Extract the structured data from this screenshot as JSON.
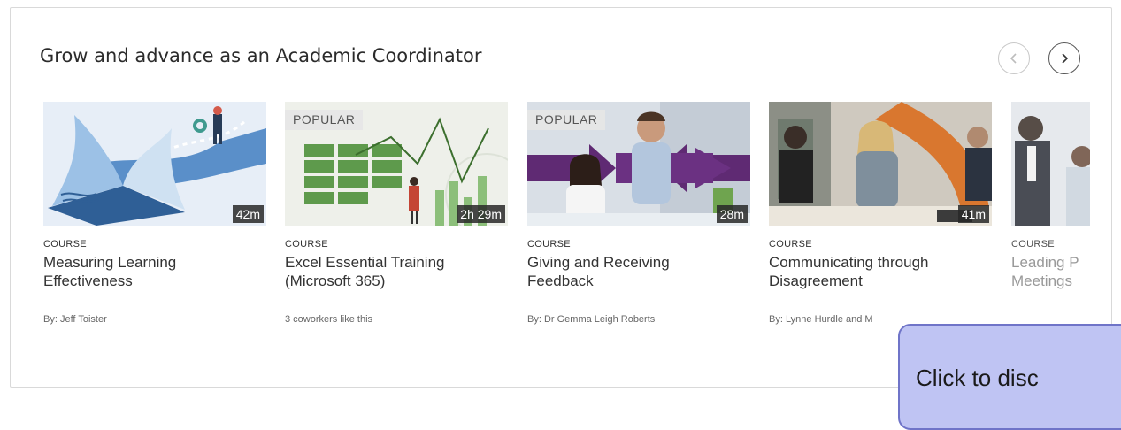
{
  "section": {
    "title": "Grow and advance as an Academic Coordinator"
  },
  "nav": {
    "prev_icon": "chevron-left-icon",
    "next_icon": "chevron-right-icon"
  },
  "cards": [
    {
      "kind": "COURSE",
      "title": "Measuring Learning Effectiveness",
      "byline": "By: Jeff Toister",
      "duration": "42m"
    },
    {
      "kind": "COURSE",
      "title": "Excel Essential Training (Microsoft 365)",
      "byline": "3 coworkers like this",
      "duration": "2h 29m",
      "badge": "POPULAR"
    },
    {
      "kind": "COURSE",
      "title": "Giving and Receiving Feedback",
      "byline": "By: Dr Gemma Leigh Roberts",
      "duration": "28m",
      "badge": "POPULAR"
    },
    {
      "kind": "COURSE",
      "title": "Communicating through Disagreement",
      "byline": "By: Lynne Hurdle and M",
      "duration": "41m"
    },
    {
      "kind": "COURSE",
      "title": "Leading P Meetings",
      "byline": ""
    }
  ],
  "popup": {
    "text": "Click to disc"
  }
}
